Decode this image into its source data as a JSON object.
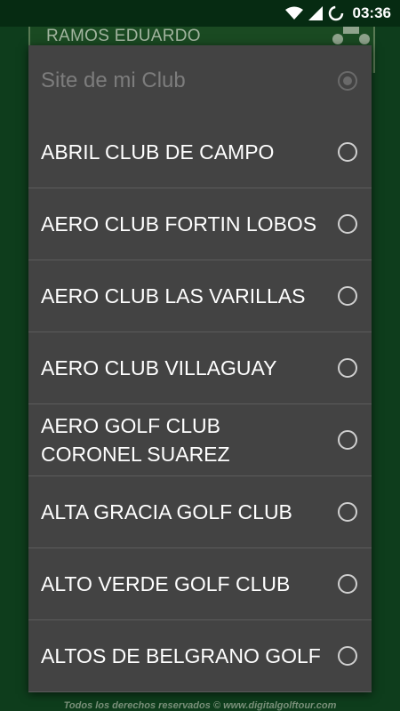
{
  "status_bar": {
    "time": "03:36",
    "icons": [
      "wifi-icon",
      "cell-signal-icon",
      "battery-charging-icon"
    ]
  },
  "background": {
    "player_name": "RAMOS EDUARDO",
    "footer_text": "Todos los derechos reservados © www.digitalgolftour.com"
  },
  "dialog": {
    "title": "Site de mi Club",
    "items": [
      {
        "label": "ABRIL CLUB DE CAMPO"
      },
      {
        "label": "AERO CLUB FORTIN LOBOS"
      },
      {
        "label": "AERO CLUB LAS VARILLAS"
      },
      {
        "label": "AERO CLUB VILLAGUAY"
      },
      {
        "label": "AERO GOLF CLUB CORONEL SUAREZ"
      },
      {
        "label": "ALTA GRACIA GOLF CLUB"
      },
      {
        "label": "ALTO VERDE GOLF CLUB"
      },
      {
        "label": "ALTOS DE BELGRANO GOLF"
      }
    ]
  },
  "colors": {
    "dialog_bg": "#434343",
    "divider": "#5c5c5c",
    "app_bg": "#0e3d1c"
  }
}
